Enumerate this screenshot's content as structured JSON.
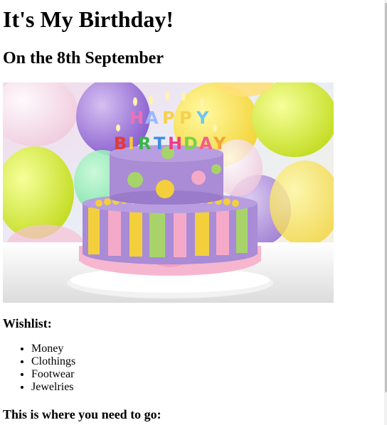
{
  "heading": "It's My Birthday!",
  "subheading": "On the 8th September",
  "cake_topper": {
    "line1": [
      "H",
      "A",
      "P",
      "P",
      "Y"
    ],
    "line2": [
      "B",
      "I",
      "R",
      "T",
      "H",
      "D",
      "A",
      "Y"
    ]
  },
  "wishlist_title": "Wishlist:",
  "wishlist": [
    "Money",
    "Clothings",
    "Footwear",
    "Jewelries"
  ],
  "directions_title": "This is where you need to go:",
  "colors": {
    "cake_purple": "#a98bd6",
    "cake_pink": "#f5a9c8",
    "ribbon_pink": "#f7b6cf",
    "accent_yellow": "#f4cf3c",
    "accent_green": "#a7d36a"
  }
}
